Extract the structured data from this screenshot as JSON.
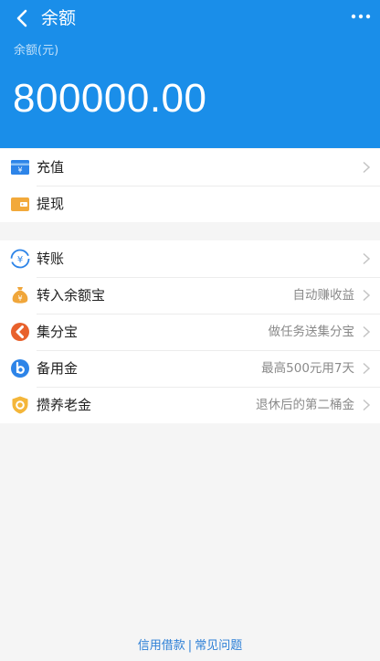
{
  "nav": {
    "title": "余额",
    "back_icon": "chevron-left-icon",
    "more_icon": "more-dots-icon"
  },
  "balance": {
    "label": "余额(元)",
    "amount": "800000.00"
  },
  "group1": [
    {
      "label": "充值",
      "hint": "",
      "icon": "recharge-yuan-card-icon",
      "color": "#2d84e8",
      "chevron": true
    },
    {
      "label": "提现",
      "hint": "",
      "icon": "wallet-icon",
      "color": "#f2a93b",
      "chevron": false
    }
  ],
  "group2": [
    {
      "label": "转账",
      "hint": "",
      "icon": "transfer-icon",
      "color": "#2d84e8"
    },
    {
      "label": "转入余额宝",
      "hint": "自动赚收益",
      "icon": "money-bag-icon",
      "color": "#f0a63a"
    },
    {
      "label": "集分宝",
      "hint": "做任务送集分宝",
      "icon": "jifenbao-icon",
      "color": "#e8612c"
    },
    {
      "label": "备用金",
      "hint": "最高500元用7天",
      "icon": "beiyongjin-icon",
      "color": "#2d84e8"
    },
    {
      "label": "攒养老金",
      "hint": "退休后的第二桶金",
      "icon": "pension-shield-icon",
      "color": "#f4b63a"
    }
  ],
  "footer": {
    "link1": "信用借款",
    "separator": "|",
    "link2": "常见问题"
  },
  "colors": {
    "header": "#1a8ee9",
    "link": "#2c7fd6"
  }
}
